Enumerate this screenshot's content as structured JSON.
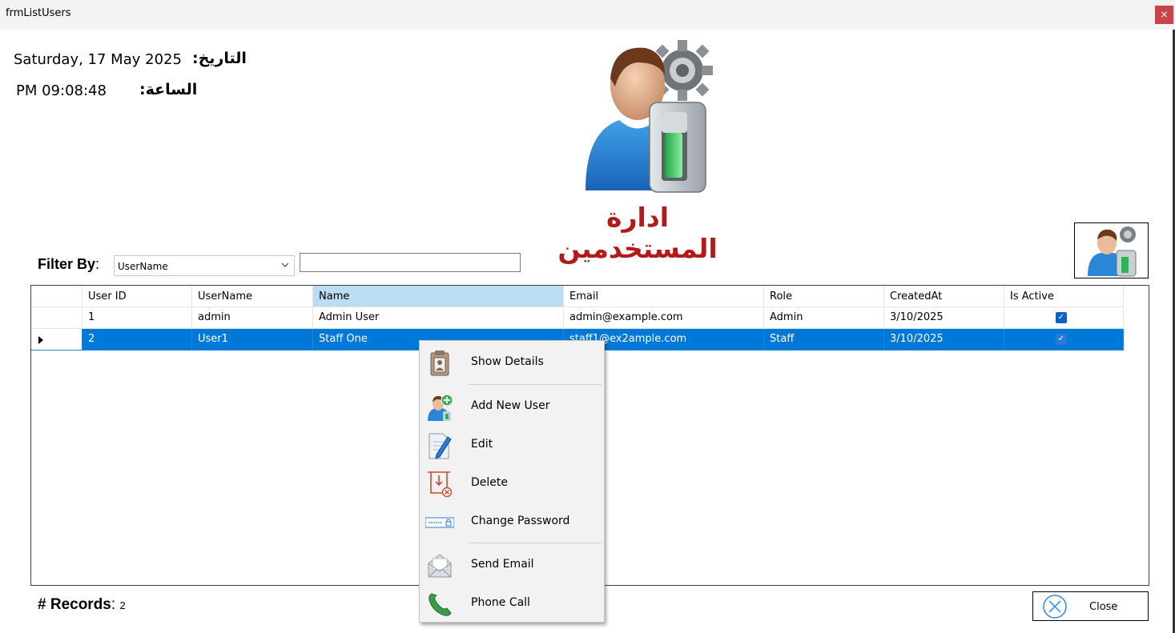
{
  "window": {
    "title": "frmListUsers",
    "close_glyph": "×"
  },
  "header": {
    "date_label": "التاريخ:",
    "date_value": "Saturday, 17 May 2025",
    "time_label": "الساعة:",
    "time_value": "PM 09:08:48",
    "page_title": "ادارة المستخدمين",
    "hero_icon": "user-settings-icon"
  },
  "filter": {
    "label": "Filter By",
    "label_colon": ":",
    "selected_option": "UserName",
    "input_value": ""
  },
  "grid": {
    "columns": [
      "User ID",
      "UserName",
      "Name",
      "Email",
      "Role",
      "CreatedAt",
      "Is Active"
    ],
    "sorted_column": "Name",
    "rows": [
      {
        "id": "1",
        "username": "admin",
        "name": "Admin User",
        "email": "admin@example.com",
        "role": "Admin",
        "created": "3/10/2025",
        "active": true,
        "selected": false
      },
      {
        "id": "2",
        "username": "User1",
        "name": "Staff One",
        "email": "staff1@ex2ample.com",
        "role": "Staff",
        "created": "3/10/2025",
        "active": true,
        "selected": true
      }
    ]
  },
  "footer": {
    "records_label": "# Records",
    "records_colon": ":",
    "records_count": "2",
    "close_label": "Close"
  },
  "context_menu": {
    "items": [
      {
        "label": "Show Details",
        "icon": "contact-card-icon"
      },
      {
        "label": "Add New User",
        "icon": "add-user-icon"
      },
      {
        "label": "Edit",
        "icon": "edit-document-icon"
      },
      {
        "label": "Delete",
        "icon": "delete-icon"
      },
      {
        "label": "Change Password",
        "icon": "password-field-icon"
      },
      {
        "label": "Send Email",
        "icon": "envelope-icon"
      },
      {
        "label": "Phone Call",
        "icon": "phone-icon"
      }
    ]
  },
  "colors": {
    "accent": "#0078d7",
    "title_red": "#b31b1b",
    "sorted_header": "#bcdcf4"
  }
}
